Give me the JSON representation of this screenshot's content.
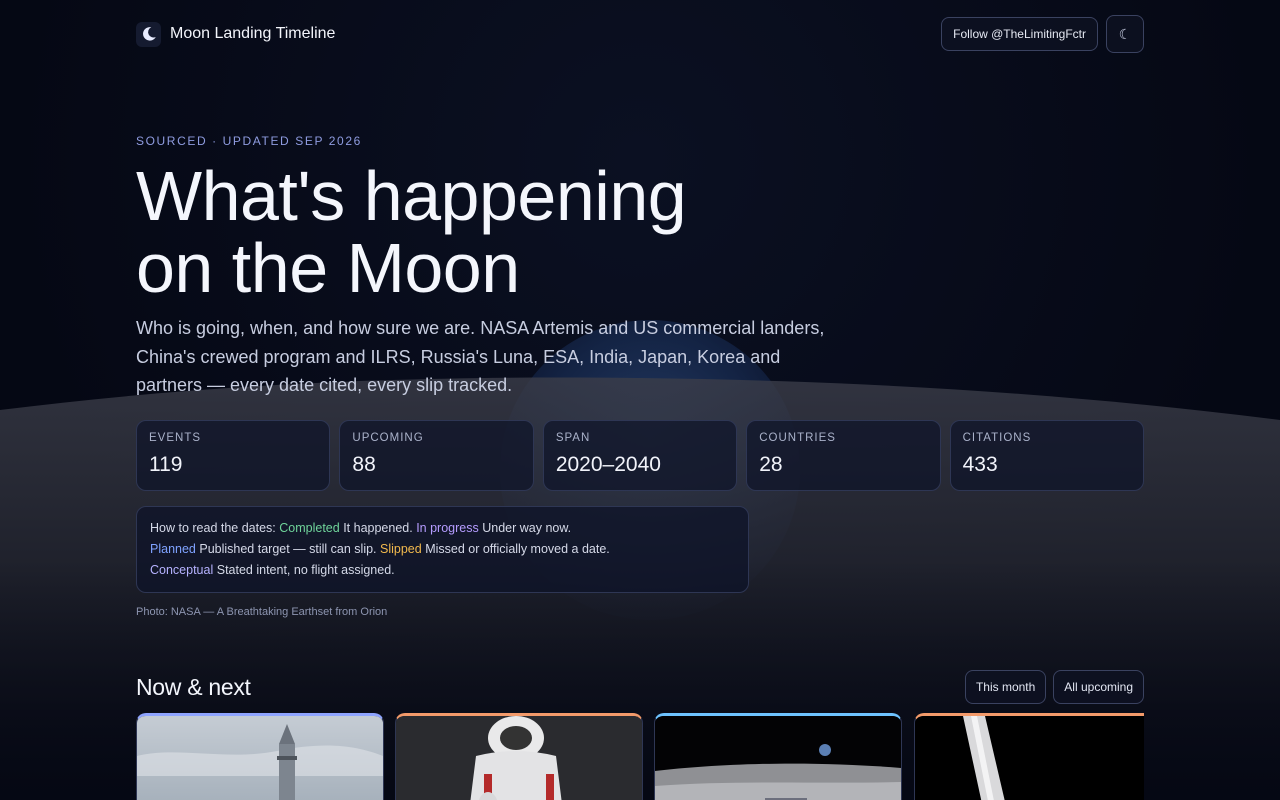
{
  "header": {
    "app_title": "Moon Landing Timeline",
    "follow_label": "Follow @TheLimitingFctr",
    "theme_glyph": "☾",
    "logo_icon": "crescent-moon-icon"
  },
  "hero": {
    "kicker": "SOURCED · UPDATED SEP 2026",
    "title_line1": "What's happening",
    "title_line2": "on the Moon",
    "subtitle": "Who is going, when, and how sure we are. NASA Artemis and US commercial landers, China's crewed program and ILRS, Russia's Luna, ESA, India, Japan, Korea and partners — every date cited, every slip tracked."
  },
  "stats": [
    {
      "label": "EVENTS",
      "value": "119"
    },
    {
      "label": "UPCOMING",
      "value": "88"
    },
    {
      "label": "SPAN",
      "value": "2020–2040"
    },
    {
      "label": "COUNTRIES",
      "value": "28"
    },
    {
      "label": "CITATIONS",
      "value": "433"
    }
  ],
  "legend": {
    "intro": "How to read the dates:",
    "completed": "Completed",
    "completed_desc": "It happened.",
    "in_progress": "In progress",
    "in_progress_desc": "Under way now.",
    "planned": "Planned",
    "planned_desc": "Published target — still can slip.",
    "slipped": "Slipped",
    "slipped_desc": "Missed or officially moved a date.",
    "conceptual": "Conceptual",
    "conceptual_desc": "Stated intent, no flight assigned."
  },
  "photo_credit": "Photo: NASA — A Breathtaking Earthset from Orion",
  "now_next": {
    "title": "Now & next",
    "filter_month": "This month",
    "filter_all": "All upcoming"
  },
  "colors": {
    "completed": "#6fd49a",
    "in_progress": "#b59cff",
    "planned": "#7fa2ff",
    "slipped": "#f1b94d",
    "conceptual": "#b6b2ff",
    "card_accents": [
      "#8fa4ff",
      "#f39a6a",
      "#6ec3ff",
      "#f39a6a"
    ]
  }
}
